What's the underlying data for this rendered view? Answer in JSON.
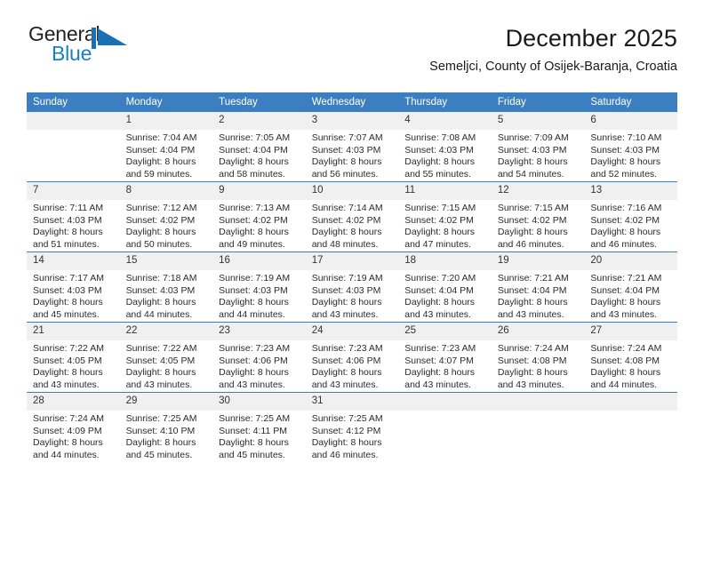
{
  "brand": {
    "name_part1": "General",
    "name_part2": "Blue",
    "accent_color": "#1a7fc1",
    "flag_icon": "blue-triangle-flag-icon"
  },
  "header": {
    "title": "December 2025",
    "subtitle": "Semeljci, County of Osijek-Baranja, Croatia",
    "header_bg": "#3c7fc0"
  },
  "weekday_headers": [
    "Sunday",
    "Monday",
    "Tuesday",
    "Wednesday",
    "Thursday",
    "Friday",
    "Saturday"
  ],
  "weeks": [
    [
      {
        "day": "",
        "sunrise": "",
        "sunset": "",
        "daylight1": "",
        "daylight2": ""
      },
      {
        "day": "1",
        "sunrise": "Sunrise: 7:04 AM",
        "sunset": "Sunset: 4:04 PM",
        "daylight1": "Daylight: 8 hours",
        "daylight2": "and 59 minutes."
      },
      {
        "day": "2",
        "sunrise": "Sunrise: 7:05 AM",
        "sunset": "Sunset: 4:04 PM",
        "daylight1": "Daylight: 8 hours",
        "daylight2": "and 58 minutes."
      },
      {
        "day": "3",
        "sunrise": "Sunrise: 7:07 AM",
        "sunset": "Sunset: 4:03 PM",
        "daylight1": "Daylight: 8 hours",
        "daylight2": "and 56 minutes."
      },
      {
        "day": "4",
        "sunrise": "Sunrise: 7:08 AM",
        "sunset": "Sunset: 4:03 PM",
        "daylight1": "Daylight: 8 hours",
        "daylight2": "and 55 minutes."
      },
      {
        "day": "5",
        "sunrise": "Sunrise: 7:09 AM",
        "sunset": "Sunset: 4:03 PM",
        "daylight1": "Daylight: 8 hours",
        "daylight2": "and 54 minutes."
      },
      {
        "day": "6",
        "sunrise": "Sunrise: 7:10 AM",
        "sunset": "Sunset: 4:03 PM",
        "daylight1": "Daylight: 8 hours",
        "daylight2": "and 52 minutes."
      }
    ],
    [
      {
        "day": "7",
        "sunrise": "Sunrise: 7:11 AM",
        "sunset": "Sunset: 4:03 PM",
        "daylight1": "Daylight: 8 hours",
        "daylight2": "and 51 minutes."
      },
      {
        "day": "8",
        "sunrise": "Sunrise: 7:12 AM",
        "sunset": "Sunset: 4:02 PM",
        "daylight1": "Daylight: 8 hours",
        "daylight2": "and 50 minutes."
      },
      {
        "day": "9",
        "sunrise": "Sunrise: 7:13 AM",
        "sunset": "Sunset: 4:02 PM",
        "daylight1": "Daylight: 8 hours",
        "daylight2": "and 49 minutes."
      },
      {
        "day": "10",
        "sunrise": "Sunrise: 7:14 AM",
        "sunset": "Sunset: 4:02 PM",
        "daylight1": "Daylight: 8 hours",
        "daylight2": "and 48 minutes."
      },
      {
        "day": "11",
        "sunrise": "Sunrise: 7:15 AM",
        "sunset": "Sunset: 4:02 PM",
        "daylight1": "Daylight: 8 hours",
        "daylight2": "and 47 minutes."
      },
      {
        "day": "12",
        "sunrise": "Sunrise: 7:15 AM",
        "sunset": "Sunset: 4:02 PM",
        "daylight1": "Daylight: 8 hours",
        "daylight2": "and 46 minutes."
      },
      {
        "day": "13",
        "sunrise": "Sunrise: 7:16 AM",
        "sunset": "Sunset: 4:02 PM",
        "daylight1": "Daylight: 8 hours",
        "daylight2": "and 46 minutes."
      }
    ],
    [
      {
        "day": "14",
        "sunrise": "Sunrise: 7:17 AM",
        "sunset": "Sunset: 4:03 PM",
        "daylight1": "Daylight: 8 hours",
        "daylight2": "and 45 minutes."
      },
      {
        "day": "15",
        "sunrise": "Sunrise: 7:18 AM",
        "sunset": "Sunset: 4:03 PM",
        "daylight1": "Daylight: 8 hours",
        "daylight2": "and 44 minutes."
      },
      {
        "day": "16",
        "sunrise": "Sunrise: 7:19 AM",
        "sunset": "Sunset: 4:03 PM",
        "daylight1": "Daylight: 8 hours",
        "daylight2": "and 44 minutes."
      },
      {
        "day": "17",
        "sunrise": "Sunrise: 7:19 AM",
        "sunset": "Sunset: 4:03 PM",
        "daylight1": "Daylight: 8 hours",
        "daylight2": "and 43 minutes."
      },
      {
        "day": "18",
        "sunrise": "Sunrise: 7:20 AM",
        "sunset": "Sunset: 4:04 PM",
        "daylight1": "Daylight: 8 hours",
        "daylight2": "and 43 minutes."
      },
      {
        "day": "19",
        "sunrise": "Sunrise: 7:21 AM",
        "sunset": "Sunset: 4:04 PM",
        "daylight1": "Daylight: 8 hours",
        "daylight2": "and 43 minutes."
      },
      {
        "day": "20",
        "sunrise": "Sunrise: 7:21 AM",
        "sunset": "Sunset: 4:04 PM",
        "daylight1": "Daylight: 8 hours",
        "daylight2": "and 43 minutes."
      }
    ],
    [
      {
        "day": "21",
        "sunrise": "Sunrise: 7:22 AM",
        "sunset": "Sunset: 4:05 PM",
        "daylight1": "Daylight: 8 hours",
        "daylight2": "and 43 minutes."
      },
      {
        "day": "22",
        "sunrise": "Sunrise: 7:22 AM",
        "sunset": "Sunset: 4:05 PM",
        "daylight1": "Daylight: 8 hours",
        "daylight2": "and 43 minutes."
      },
      {
        "day": "23",
        "sunrise": "Sunrise: 7:23 AM",
        "sunset": "Sunset: 4:06 PM",
        "daylight1": "Daylight: 8 hours",
        "daylight2": "and 43 minutes."
      },
      {
        "day": "24",
        "sunrise": "Sunrise: 7:23 AM",
        "sunset": "Sunset: 4:06 PM",
        "daylight1": "Daylight: 8 hours",
        "daylight2": "and 43 minutes."
      },
      {
        "day": "25",
        "sunrise": "Sunrise: 7:23 AM",
        "sunset": "Sunset: 4:07 PM",
        "daylight1": "Daylight: 8 hours",
        "daylight2": "and 43 minutes."
      },
      {
        "day": "26",
        "sunrise": "Sunrise: 7:24 AM",
        "sunset": "Sunset: 4:08 PM",
        "daylight1": "Daylight: 8 hours",
        "daylight2": "and 43 minutes."
      },
      {
        "day": "27",
        "sunrise": "Sunrise: 7:24 AM",
        "sunset": "Sunset: 4:08 PM",
        "daylight1": "Daylight: 8 hours",
        "daylight2": "and 44 minutes."
      }
    ],
    [
      {
        "day": "28",
        "sunrise": "Sunrise: 7:24 AM",
        "sunset": "Sunset: 4:09 PM",
        "daylight1": "Daylight: 8 hours",
        "daylight2": "and 44 minutes."
      },
      {
        "day": "29",
        "sunrise": "Sunrise: 7:25 AM",
        "sunset": "Sunset: 4:10 PM",
        "daylight1": "Daylight: 8 hours",
        "daylight2": "and 45 minutes."
      },
      {
        "day": "30",
        "sunrise": "Sunrise: 7:25 AM",
        "sunset": "Sunset: 4:11 PM",
        "daylight1": "Daylight: 8 hours",
        "daylight2": "and 45 minutes."
      },
      {
        "day": "31",
        "sunrise": "Sunrise: 7:25 AM",
        "sunset": "Sunset: 4:12 PM",
        "daylight1": "Daylight: 8 hours",
        "daylight2": "and 46 minutes."
      },
      {
        "day": "",
        "sunrise": "",
        "sunset": "",
        "daylight1": "",
        "daylight2": ""
      },
      {
        "day": "",
        "sunrise": "",
        "sunset": "",
        "daylight1": "",
        "daylight2": ""
      },
      {
        "day": "",
        "sunrise": "",
        "sunset": "",
        "daylight1": "",
        "daylight2": ""
      }
    ]
  ]
}
